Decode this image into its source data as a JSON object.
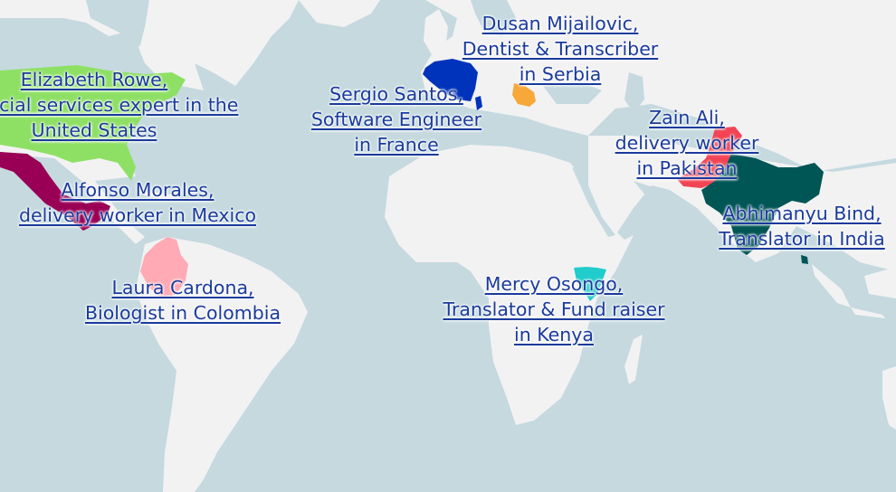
{
  "map": {
    "colors": {
      "ocean": "#c5d9df",
      "land": "#f2f2f2",
      "label_text": "#1a3a9c"
    },
    "highlighted_countries": [
      {
        "country": "United States",
        "color": "#8ee065"
      },
      {
        "country": "Mexico",
        "color": "#990055"
      },
      {
        "country": "Colombia",
        "color": "#ffaab5"
      },
      {
        "country": "France",
        "color": "#0033bb"
      },
      {
        "country": "Serbia",
        "color": "#f7a838"
      },
      {
        "country": "Pakistan",
        "color": "#f24455"
      },
      {
        "country": "India",
        "color": "#005555"
      },
      {
        "country": "Kenya",
        "color": "#22cccc"
      }
    ]
  },
  "labels": [
    {
      "id": "usa",
      "lines": [
        "Elizabeth Rowe,",
        "Financial services expert in the",
        "United States"
      ]
    },
    {
      "id": "mexico",
      "lines": [
        "Alfonso Morales,",
        "delivery worker in Mexico"
      ]
    },
    {
      "id": "colombia",
      "lines": [
        "Laura Cardona,",
        "Biologist in Colombia"
      ]
    },
    {
      "id": "france",
      "lines": [
        "Sergio Santos,",
        "Software Engineer",
        "in France"
      ]
    },
    {
      "id": "serbia",
      "lines": [
        "Dusan Mijailovic,",
        "Dentist & Transcriber",
        "in Serbia"
      ]
    },
    {
      "id": "pakistan",
      "lines": [
        "Zain Ali,",
        "delivery worker",
        "in Pakistan"
      ]
    },
    {
      "id": "india",
      "lines": [
        "Abhimanyu Bind,",
        "Translator in India"
      ]
    },
    {
      "id": "kenya",
      "lines": [
        "Mercy Osongo,",
        "Translator & Fund raiser",
        "in Kenya"
      ]
    }
  ]
}
